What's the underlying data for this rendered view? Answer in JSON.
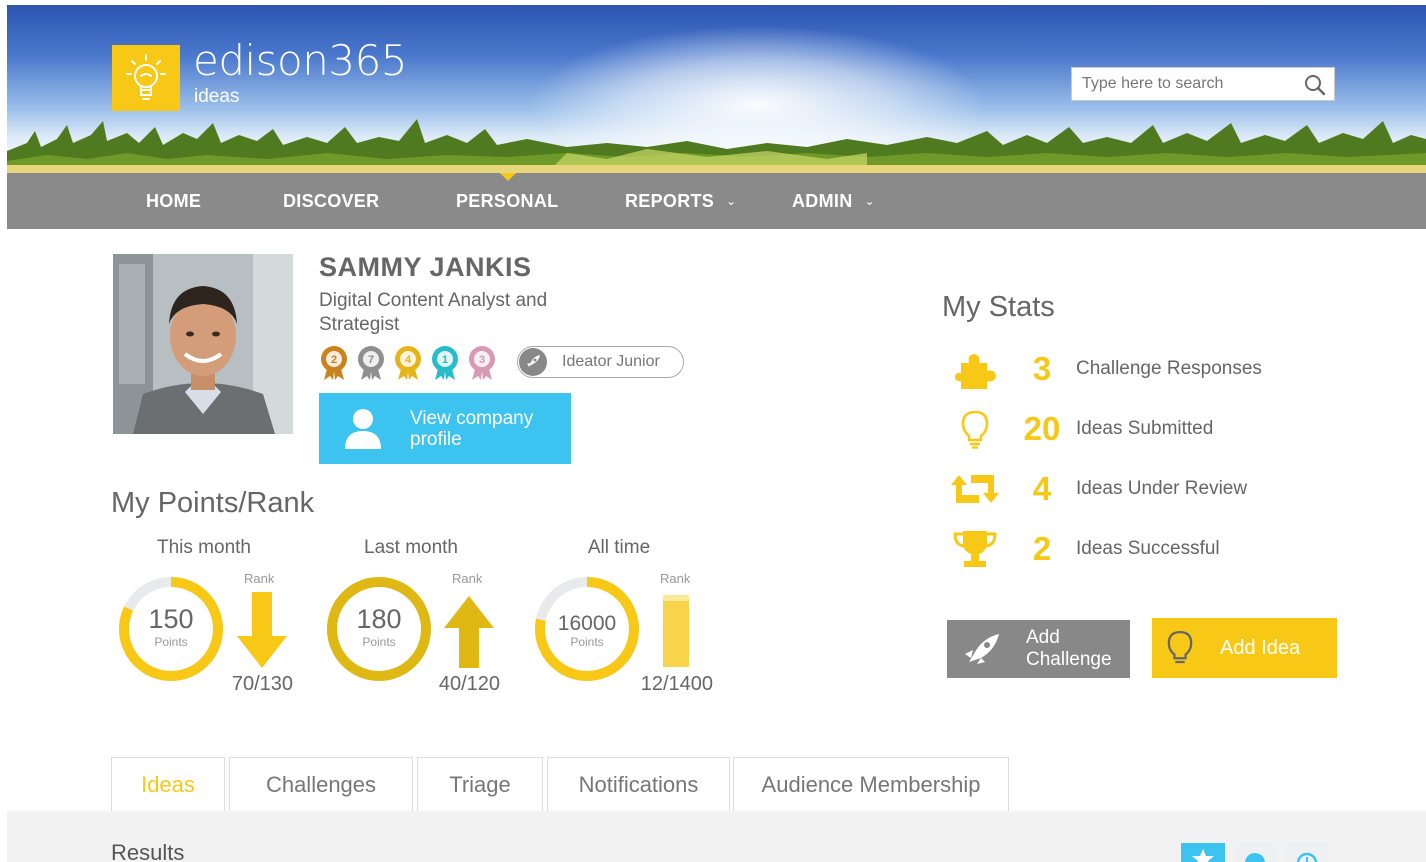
{
  "app": {
    "logo_name": "edison365",
    "logo_sub": "ideas",
    "search_placeholder": "Type here to search"
  },
  "nav": {
    "items": [
      {
        "label": "HOME"
      },
      {
        "label": "DISCOVER"
      },
      {
        "label": "PERSONAL",
        "active": true
      },
      {
        "label": "REPORTS",
        "has_dropdown": true
      },
      {
        "label": "ADMIN",
        "has_dropdown": true
      }
    ]
  },
  "profile": {
    "name": "SAMMY JANKIS",
    "title": "Digital Content Analyst and Strategist",
    "badges": [
      {
        "value": "2",
        "color": "#c9821e"
      },
      {
        "value": "7",
        "color": "#8f8f8f"
      },
      {
        "value": "4",
        "color": "#e6b418"
      },
      {
        "value": "1",
        "color": "#28bccb"
      },
      {
        "value": "3",
        "color": "#d79ab5"
      }
    ],
    "level": "Ideator Junior",
    "company_button": "View company profile"
  },
  "points": {
    "title": "My Points/Rank",
    "rank_label": "Rank",
    "points_label": "Points",
    "periods": [
      {
        "label": "This month",
        "points": "150",
        "rank": "70/130",
        "fill": 0.82,
        "trend": "down"
      },
      {
        "label": "Last month",
        "points": "180",
        "rank": "40/120",
        "fill": 1.0,
        "trend": "up"
      },
      {
        "label": "All time",
        "points": "16000",
        "rank": "12/1400",
        "fill": 0.78,
        "trend": "steady"
      }
    ]
  },
  "stats": {
    "title": "My Stats",
    "rows": [
      {
        "icon": "puzzle-icon",
        "value": "3",
        "label": "Challenge Responses"
      },
      {
        "icon": "lightbulb-icon",
        "value": "20",
        "label": "Ideas Submitted"
      },
      {
        "icon": "review-arrows-icon",
        "value": "4",
        "label": "Ideas Under Review"
      },
      {
        "icon": "trophy-icon",
        "value": "2",
        "label": "Ideas Successful"
      }
    ],
    "add_challenge": "Add Challenge",
    "add_idea": "Add Idea"
  },
  "tabs": [
    {
      "label": "Ideas",
      "active": true
    },
    {
      "label": "Challenges"
    },
    {
      "label": "Triage"
    },
    {
      "label": "Notifications"
    },
    {
      "label": "Audience Membership"
    }
  ],
  "results": {
    "title": "Results"
  },
  "colors": {
    "accent": "#f7c815",
    "nav": "#8a8a8a",
    "info": "#3cc3ef"
  }
}
